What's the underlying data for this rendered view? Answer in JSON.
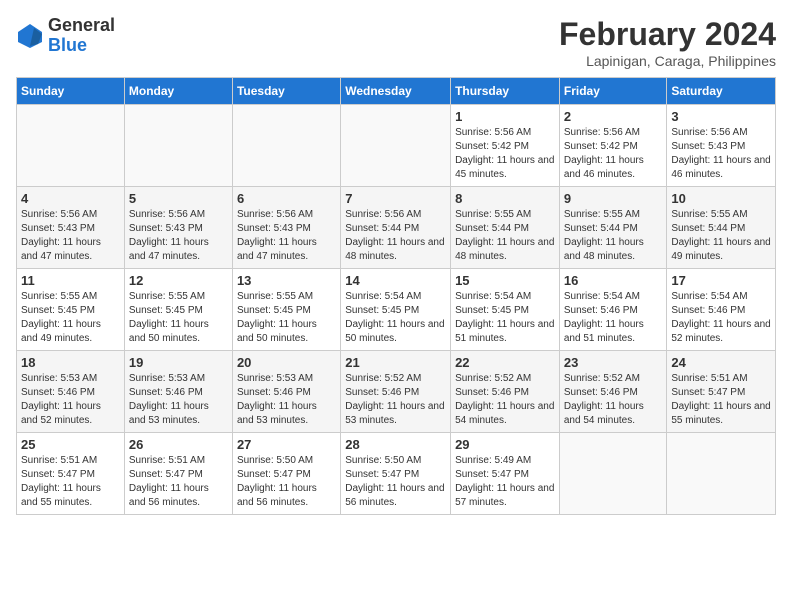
{
  "header": {
    "logo_general": "General",
    "logo_blue": "Blue",
    "month_year": "February 2024",
    "location": "Lapinigan, Caraga, Philippines"
  },
  "days_of_week": [
    "Sunday",
    "Monday",
    "Tuesday",
    "Wednesday",
    "Thursday",
    "Friday",
    "Saturday"
  ],
  "weeks": [
    [
      {
        "day": "",
        "details": ""
      },
      {
        "day": "",
        "details": ""
      },
      {
        "day": "",
        "details": ""
      },
      {
        "day": "",
        "details": ""
      },
      {
        "day": "1",
        "sunrise": "Sunrise: 5:56 AM",
        "sunset": "Sunset: 5:42 PM",
        "daylight": "Daylight: 11 hours and 45 minutes."
      },
      {
        "day": "2",
        "sunrise": "Sunrise: 5:56 AM",
        "sunset": "Sunset: 5:42 PM",
        "daylight": "Daylight: 11 hours and 46 minutes."
      },
      {
        "day": "3",
        "sunrise": "Sunrise: 5:56 AM",
        "sunset": "Sunset: 5:43 PM",
        "daylight": "Daylight: 11 hours and 46 minutes."
      }
    ],
    [
      {
        "day": "4",
        "sunrise": "Sunrise: 5:56 AM",
        "sunset": "Sunset: 5:43 PM",
        "daylight": "Daylight: 11 hours and 47 minutes."
      },
      {
        "day": "5",
        "sunrise": "Sunrise: 5:56 AM",
        "sunset": "Sunset: 5:43 PM",
        "daylight": "Daylight: 11 hours and 47 minutes."
      },
      {
        "day": "6",
        "sunrise": "Sunrise: 5:56 AM",
        "sunset": "Sunset: 5:43 PM",
        "daylight": "Daylight: 11 hours and 47 minutes."
      },
      {
        "day": "7",
        "sunrise": "Sunrise: 5:56 AM",
        "sunset": "Sunset: 5:44 PM",
        "daylight": "Daylight: 11 hours and 48 minutes."
      },
      {
        "day": "8",
        "sunrise": "Sunrise: 5:55 AM",
        "sunset": "Sunset: 5:44 PM",
        "daylight": "Daylight: 11 hours and 48 minutes."
      },
      {
        "day": "9",
        "sunrise": "Sunrise: 5:55 AM",
        "sunset": "Sunset: 5:44 PM",
        "daylight": "Daylight: 11 hours and 48 minutes."
      },
      {
        "day": "10",
        "sunrise": "Sunrise: 5:55 AM",
        "sunset": "Sunset: 5:44 PM",
        "daylight": "Daylight: 11 hours and 49 minutes."
      }
    ],
    [
      {
        "day": "11",
        "sunrise": "Sunrise: 5:55 AM",
        "sunset": "Sunset: 5:45 PM",
        "daylight": "Daylight: 11 hours and 49 minutes."
      },
      {
        "day": "12",
        "sunrise": "Sunrise: 5:55 AM",
        "sunset": "Sunset: 5:45 PM",
        "daylight": "Daylight: 11 hours and 50 minutes."
      },
      {
        "day": "13",
        "sunrise": "Sunrise: 5:55 AM",
        "sunset": "Sunset: 5:45 PM",
        "daylight": "Daylight: 11 hours and 50 minutes."
      },
      {
        "day": "14",
        "sunrise": "Sunrise: 5:54 AM",
        "sunset": "Sunset: 5:45 PM",
        "daylight": "Daylight: 11 hours and 50 minutes."
      },
      {
        "day": "15",
        "sunrise": "Sunrise: 5:54 AM",
        "sunset": "Sunset: 5:45 PM",
        "daylight": "Daylight: 11 hours and 51 minutes."
      },
      {
        "day": "16",
        "sunrise": "Sunrise: 5:54 AM",
        "sunset": "Sunset: 5:46 PM",
        "daylight": "Daylight: 11 hours and 51 minutes."
      },
      {
        "day": "17",
        "sunrise": "Sunrise: 5:54 AM",
        "sunset": "Sunset: 5:46 PM",
        "daylight": "Daylight: 11 hours and 52 minutes."
      }
    ],
    [
      {
        "day": "18",
        "sunrise": "Sunrise: 5:53 AM",
        "sunset": "Sunset: 5:46 PM",
        "daylight": "Daylight: 11 hours and 52 minutes."
      },
      {
        "day": "19",
        "sunrise": "Sunrise: 5:53 AM",
        "sunset": "Sunset: 5:46 PM",
        "daylight": "Daylight: 11 hours and 53 minutes."
      },
      {
        "day": "20",
        "sunrise": "Sunrise: 5:53 AM",
        "sunset": "Sunset: 5:46 PM",
        "daylight": "Daylight: 11 hours and 53 minutes."
      },
      {
        "day": "21",
        "sunrise": "Sunrise: 5:52 AM",
        "sunset": "Sunset: 5:46 PM",
        "daylight": "Daylight: 11 hours and 53 minutes."
      },
      {
        "day": "22",
        "sunrise": "Sunrise: 5:52 AM",
        "sunset": "Sunset: 5:46 PM",
        "daylight": "Daylight: 11 hours and 54 minutes."
      },
      {
        "day": "23",
        "sunrise": "Sunrise: 5:52 AM",
        "sunset": "Sunset: 5:46 PM",
        "daylight": "Daylight: 11 hours and 54 minutes."
      },
      {
        "day": "24",
        "sunrise": "Sunrise: 5:51 AM",
        "sunset": "Sunset: 5:47 PM",
        "daylight": "Daylight: 11 hours and 55 minutes."
      }
    ],
    [
      {
        "day": "25",
        "sunrise": "Sunrise: 5:51 AM",
        "sunset": "Sunset: 5:47 PM",
        "daylight": "Daylight: 11 hours and 55 minutes."
      },
      {
        "day": "26",
        "sunrise": "Sunrise: 5:51 AM",
        "sunset": "Sunset: 5:47 PM",
        "daylight": "Daylight: 11 hours and 56 minutes."
      },
      {
        "day": "27",
        "sunrise": "Sunrise: 5:50 AM",
        "sunset": "Sunset: 5:47 PM",
        "daylight": "Daylight: 11 hours and 56 minutes."
      },
      {
        "day": "28",
        "sunrise": "Sunrise: 5:50 AM",
        "sunset": "Sunset: 5:47 PM",
        "daylight": "Daylight: 11 hours and 56 minutes."
      },
      {
        "day": "29",
        "sunrise": "Sunrise: 5:49 AM",
        "sunset": "Sunset: 5:47 PM",
        "daylight": "Daylight: 11 hours and 57 minutes."
      },
      {
        "day": "",
        "details": ""
      },
      {
        "day": "",
        "details": ""
      }
    ]
  ]
}
